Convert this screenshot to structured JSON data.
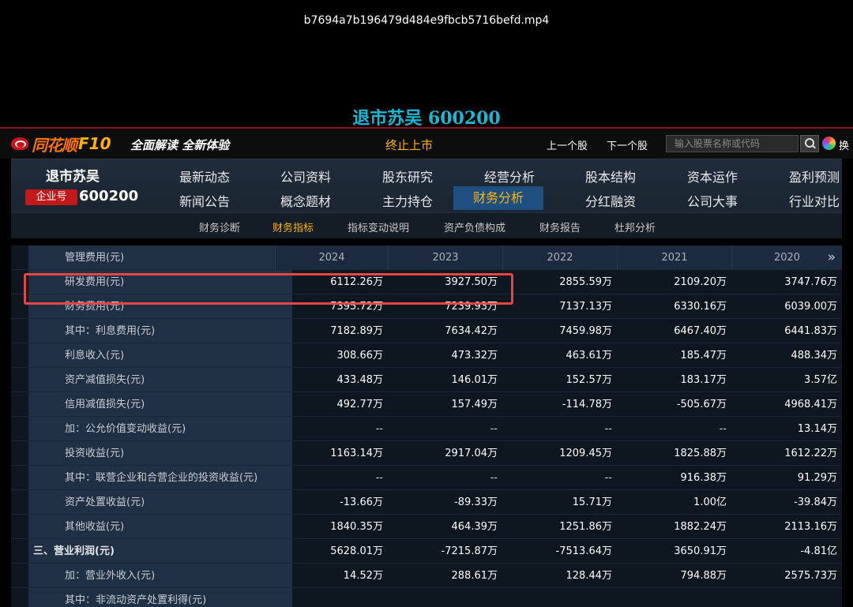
{
  "video_filename": "b7694a7b196479d484e9fbcb5716befd.mp4",
  "page_title": "退市苏吴 600200",
  "topbar": {
    "logo_text": "同花顺",
    "logo_f10": "F10",
    "slogan": "全面解读 全新体验",
    "status": "终止上市",
    "prev_label": "上一个股",
    "next_label": "下一个股",
    "search_placeholder": "输入股票名称或代码",
    "switch_label": "换"
  },
  "company": {
    "name": "退市苏吴",
    "badge": "企业号",
    "code": "600200"
  },
  "nav_row1": [
    "最新动态",
    "公司资料",
    "股东研究",
    "经营分析",
    "股本结构",
    "资本运作",
    "盈利预测"
  ],
  "nav_row2": [
    "新闻公告",
    "概念题材",
    "主力持仓",
    "财务分析",
    "分红融资",
    "公司大事",
    "行业对比"
  ],
  "nav_active": "财务分析",
  "subnav": [
    "财务诊断",
    "财务指标",
    "指标变动说明",
    "资产负债构成",
    "财务报告",
    "杜邦分析"
  ],
  "subnav_active": "财务指标",
  "colors": {
    "accent": "#ffb700",
    "highlight": "#e84545",
    "title": "#19b8d4"
  },
  "table": {
    "years": [
      "2024",
      "2023",
      "2022",
      "2021",
      "2020"
    ],
    "rows": [
      {
        "label": "研发费用(元)",
        "values": [
          "6112.26万",
          "3927.50万",
          "2855.59万",
          "2109.20万",
          "3747.76万"
        ],
        "section": false
      },
      {
        "label": "财务费用(元)",
        "values": [
          "7395.72万",
          "7239.93万",
          "7137.13万",
          "6330.16万",
          "6039.00万"
        ],
        "section": false
      },
      {
        "label": "其中：利息费用(元)",
        "values": [
          "7182.89万",
          "7634.42万",
          "7459.98万",
          "6467.40万",
          "6441.83万"
        ],
        "section": false
      },
      {
        "label": "利息收入(元)",
        "values": [
          "308.66万",
          "473.32万",
          "463.61万",
          "185.47万",
          "488.34万"
        ],
        "section": false
      },
      {
        "label": "资产减值损失(元)",
        "values": [
          "433.48万",
          "146.01万",
          "152.57万",
          "183.17万",
          "3.57亿"
        ],
        "section": false
      },
      {
        "label": "信用减值损失(元)",
        "values": [
          "492.77万",
          "157.49万",
          "-114.78万",
          "-505.67万",
          "4968.41万"
        ],
        "section": false
      },
      {
        "label": "加：公允价值变动收益(元)",
        "values": [
          "--",
          "--",
          "--",
          "--",
          "13.14万"
        ],
        "section": false
      },
      {
        "label": "投资收益(元)",
        "values": [
          "1163.14万",
          "2917.04万",
          "1209.45万",
          "1825.88万",
          "1612.22万"
        ],
        "section": false
      },
      {
        "label": "其中：联营企业和合营企业的投资收益(元)",
        "values": [
          "--",
          "--",
          "--",
          "916.38万",
          "91.29万"
        ],
        "section": false
      },
      {
        "label": "资产处置收益(元)",
        "values": [
          "-13.66万",
          "-89.33万",
          "15.71万",
          "1.00亿",
          "-39.84万"
        ],
        "section": false
      },
      {
        "label": "其他收益(元)",
        "values": [
          "1840.35万",
          "464.39万",
          "1251.86万",
          "1882.24万",
          "2113.16万"
        ],
        "section": false
      },
      {
        "label": "三、营业利润(元)",
        "values": [
          "5628.01万",
          "-7215.87万",
          "-7513.64万",
          "3650.91万",
          "-4.81亿"
        ],
        "section": true
      },
      {
        "label": "加：营业外收入(元)",
        "values": [
          "14.52万",
          "288.61万",
          "128.44万",
          "794.88万",
          "2575.73万"
        ],
        "section": false
      },
      {
        "label": "其中：非流动资产处置利得(元)",
        "values": [
          "",
          "",
          "",
          "",
          ""
        ],
        "section": false
      }
    ],
    "header_label": "管理费用(元)"
  }
}
